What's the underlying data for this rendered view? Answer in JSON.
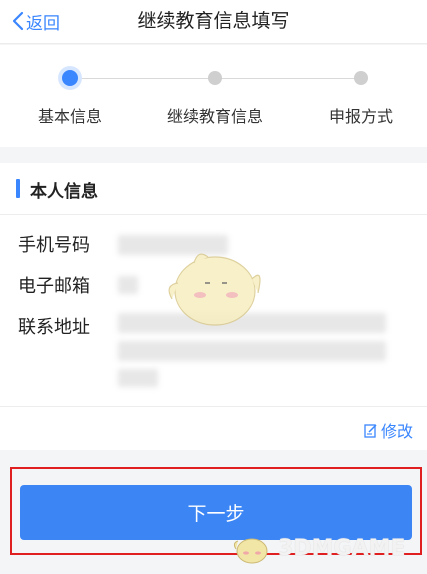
{
  "header": {
    "back_label": "返回",
    "title": "继续教育信息填写"
  },
  "steps": [
    {
      "label": "基本信息",
      "active": true
    },
    {
      "label": "继续教育信息",
      "active": false
    },
    {
      "label": "申报方式",
      "active": false
    }
  ],
  "section": {
    "title": "本人信息",
    "fields": [
      {
        "label": "手机号码"
      },
      {
        "label": "电子邮箱"
      },
      {
        "label": "联系地址"
      }
    ]
  },
  "edit": {
    "label": "修改"
  },
  "next_button": {
    "label": "下一步"
  },
  "watermark": {
    "text": "3DMGAME"
  },
  "colors": {
    "accent": "#3a86ff",
    "button": "#3b85f5",
    "highlight": "#e02020",
    "background": "#f4f5f7"
  }
}
